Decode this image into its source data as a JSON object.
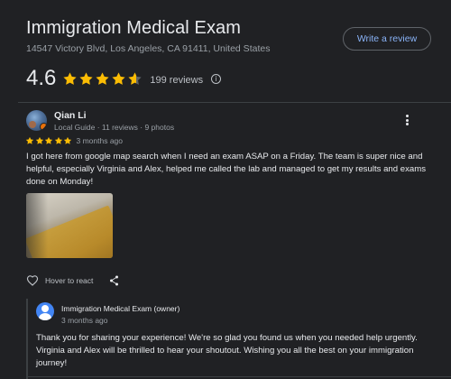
{
  "place": {
    "title": "Immigration Medical Exam",
    "address": "14547 Victory Blvd, Los Angeles, CA 91411, United States",
    "write_review_label": "Write a review",
    "rating": "4.6",
    "review_count": "199 reviews",
    "info_glyph": "i",
    "star_color": "#fbbc04"
  },
  "review": {
    "reviewer_name": "Qian Li",
    "reviewer_meta": "Local Guide · 11 reviews · 9 photos",
    "stars": 5,
    "date": "3 months ago",
    "text": "I got here from google map search when I need an exam ASAP on a Friday. The team is super nice and helpful, especially Virginia and Alex, helped me called the lab and managed to get my results and exams done on Monday!",
    "react_label": "Hover to react"
  },
  "owner_response": {
    "name": "Immigration Medical Exam (owner)",
    "date": "3 months ago",
    "text": "Thank you for sharing your experience! We're so glad you found us when you needed help urgently. Virginia and Alex will be thrilled to hear your shoutout. Wishing you all the best on your immigration journey!"
  },
  "colors": {
    "background": "#202124",
    "link_blue": "#8ab4f8",
    "owner_avatar": "#4285f4"
  }
}
